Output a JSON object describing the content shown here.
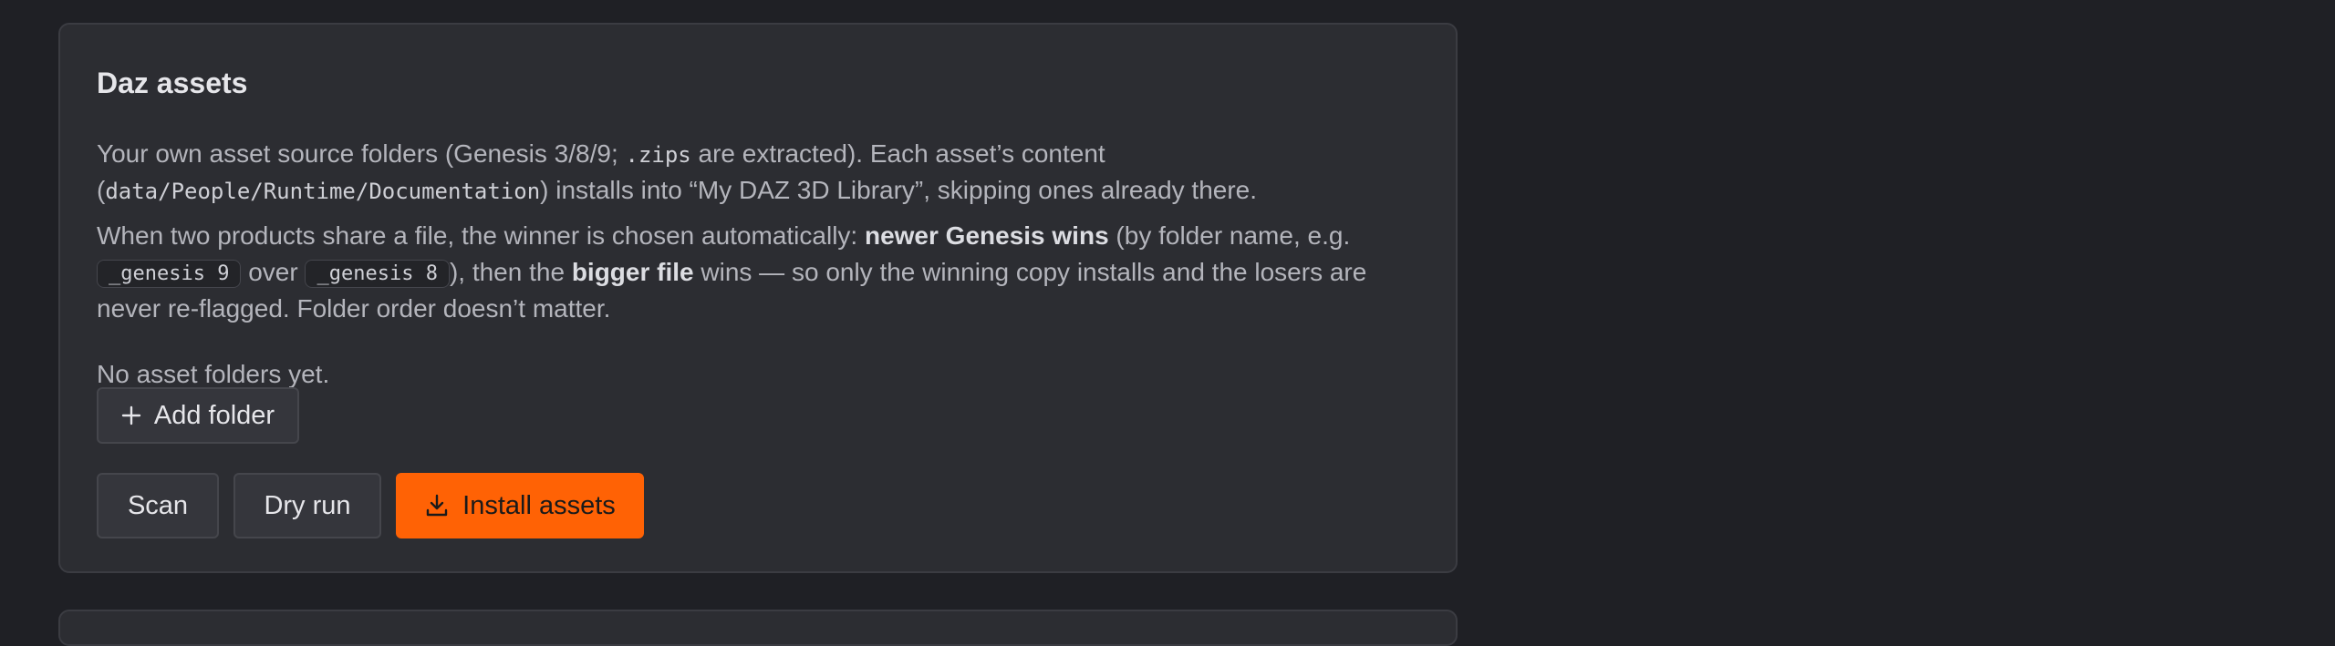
{
  "card": {
    "title": "Daz assets",
    "p1": {
      "line1_a": "Your own asset source folders (Genesis 3/8/9; ",
      "line1_code": ".zips",
      "line1_b": " are extracted). Each asset’s content",
      "line2_a": "(",
      "line2_code": "data/People/Runtime/Documentation",
      "line2_b": ") installs into “My DAZ 3D Library”, skipping ones already there."
    },
    "p2": {
      "line1_a": "When two products share a file, the winner is chosen automatically: ",
      "line1_bold": "newer Genesis wins",
      "line1_b": " (by folder name, e.g.",
      "line2_pill1": "_genesis 9",
      "line2_a": " over ",
      "line2_pill2": "_genesis 8",
      "line2_b": "), then the ",
      "line2_bold": "bigger file",
      "line2_c": " wins — so only the winning copy installs and the losers are",
      "line3": "never re-flagged. Folder order doesn’t matter."
    },
    "empty_text": "No asset folders yet.",
    "buttons": {
      "add_folder": "Add folder",
      "scan": "Scan",
      "dry_run": "Dry run",
      "install_assets": "Install assets"
    }
  },
  "colors": {
    "background": "#1f2025",
    "card": "#2c2d32",
    "accent": "#ff6205"
  },
  "icons": {
    "add": "plus-icon",
    "install": "download-icon"
  }
}
